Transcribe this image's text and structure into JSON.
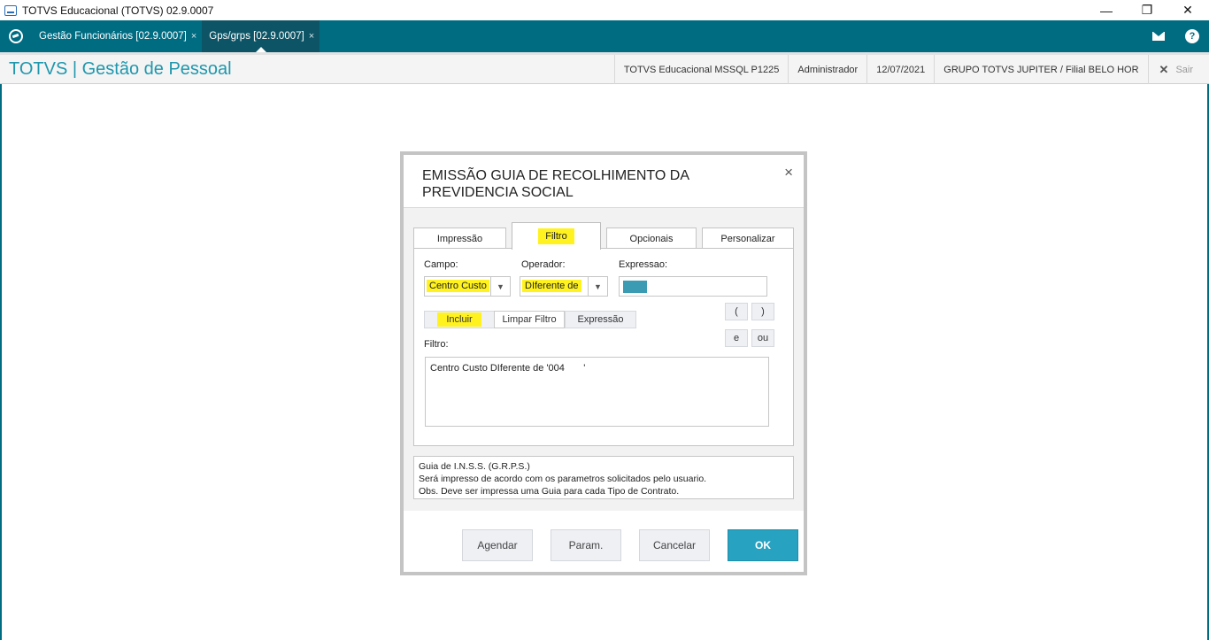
{
  "window": {
    "title": "TOTVS Educacional (TOTVS) 02.9.0007",
    "minimize": "—",
    "restore": "❐",
    "close": "✕"
  },
  "topbar": {
    "tabs": [
      {
        "label": "Gestão Funcionários [02.9.0007]",
        "close": "×"
      },
      {
        "label": "Gps/grps [02.9.0007]",
        "close": "×"
      }
    ],
    "help": "?"
  },
  "subheader": {
    "title": "TOTVS | Gestão de Pessoal",
    "environment": "TOTVS Educacional MSSQL P1225",
    "user": "Administrador",
    "date": "12/07/2021",
    "company": "GRUPO TOTVS JUPITER / Filial BELO HOR",
    "exit_icon": "✕",
    "exit": "Sair"
  },
  "dialog": {
    "title": "EMISSÃO GUIA DE RECOLHIMENTO DA PREVIDENCIA SOCIAL",
    "close": "×",
    "tabs": [
      "Impressão",
      "Filtro",
      "Opcionais",
      "Personalizar"
    ],
    "campo_label": "Campo:",
    "campo_value": "Centro Custo",
    "operador_label": "Operador:",
    "operador_value": "DIferente de",
    "expressao_label": "Expressao:",
    "buttons": {
      "incluir": "Incluir",
      "limpar": "Limpar Filtro",
      "expressao": "Expressão",
      "open_paren": "(",
      "close_paren": ")",
      "and": "e",
      "or": "ou"
    },
    "filtro_label": "Filtro:",
    "filtro_text": "Centro Custo DIferente de '004       '",
    "description": [
      "Guia de I.N.S.S. (G.R.P.S.)",
      "Será impresso de acordo com os parametros solicitados pelo usuario.",
      "Obs. Deve ser impressa uma Guia para cada Tipo de Contrato."
    ],
    "footer": {
      "agendar": "Agendar",
      "param": "Param.",
      "cancelar": "Cancelar",
      "ok": "OK"
    }
  },
  "colors": {
    "topbar": "#006c82",
    "accent": "#27a2c1",
    "highlight": "#fff21f"
  }
}
